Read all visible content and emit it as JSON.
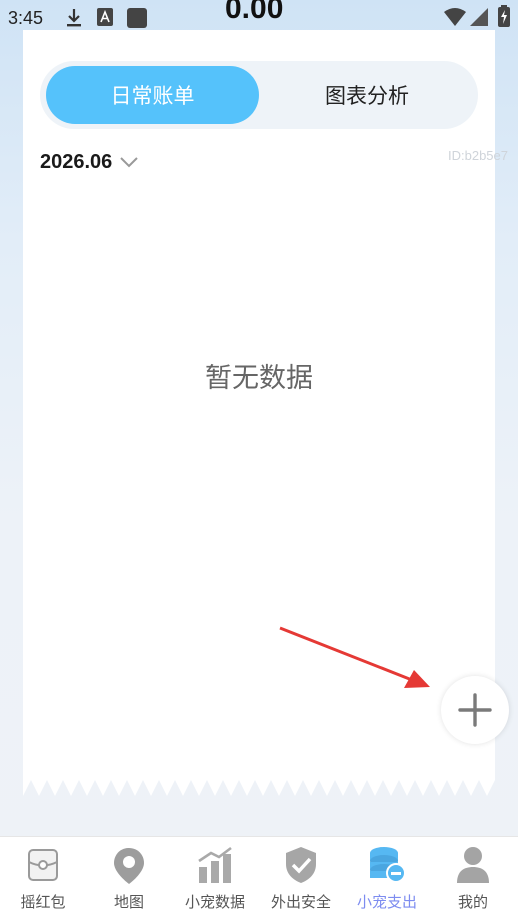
{
  "status_bar": {
    "time": "3:45",
    "amount": "0.00",
    "icons": [
      "download-icon",
      "text-a-icon",
      "square-icon",
      "wifi-icon",
      "signal-icon",
      "battery-icon"
    ]
  },
  "tabs": [
    {
      "label": "日常账单",
      "active": true
    },
    {
      "label": "图表分析",
      "active": false
    }
  ],
  "month": {
    "value": "2026.06",
    "icon": "chevron-down-icon"
  },
  "id_label": "ID:b2b5e7",
  "empty_text": "暂无数据",
  "add_button": {
    "icon": "plus-icon"
  },
  "colors": {
    "accent": "#55c2fb",
    "nav_active": "#7d8cf0",
    "arrow": "#e53935"
  },
  "bottom_nav": [
    {
      "label": "摇红包",
      "icon": "red-packet-icon"
    },
    {
      "label": "地图",
      "icon": "map-pin-icon"
    },
    {
      "label": "小宠数据",
      "icon": "bar-chart-icon"
    },
    {
      "label": "外出安全",
      "icon": "shield-check-icon"
    },
    {
      "label": "小宠支出",
      "icon": "coins-icon",
      "active": true
    },
    {
      "label": "我的",
      "icon": "person-icon"
    }
  ]
}
